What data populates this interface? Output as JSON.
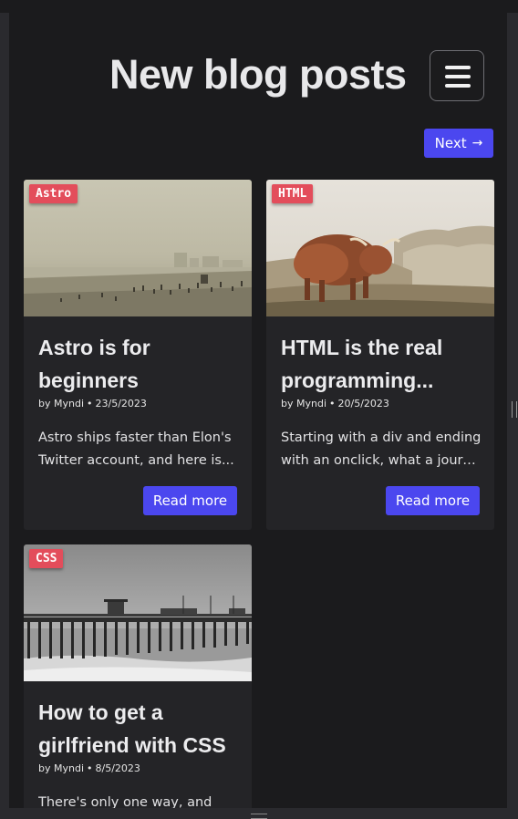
{
  "header": {
    "title": "New blog posts",
    "menu_icon": "hamburger-menu-icon"
  },
  "pagination": {
    "next_label": "Next",
    "next_icon": "→"
  },
  "colors": {
    "accent": "#4b47ef",
    "tag": "#e34d5b",
    "background": "#1b1b1d",
    "card": "#242427"
  },
  "posts": [
    {
      "tag": "Astro",
      "title_line1": "Astro is for",
      "title_line2": "beginners",
      "author": "by Myndi",
      "date": "23/5/2023",
      "excerpt_line1": "Astro ships faster than Elon's",
      "excerpt_line2": "Twitter account, and here is...",
      "read_more": "Read more",
      "image": "foggy-beach-photo"
    },
    {
      "tag": "HTML",
      "title_line1": "HTML is the real",
      "title_line2": "programming...",
      "author": "by Myndi",
      "date": "20/5/2023",
      "excerpt_line1": "Starting with a div and ending",
      "excerpt_line2": "with an onclick, what a journey.",
      "read_more": "Read more",
      "image": "highland-cow-photo"
    },
    {
      "tag": "CSS",
      "title_line1": "How to get a",
      "title_line2": "girlfriend with CSS",
      "author": "by Myndi",
      "date": "8/5/2023",
      "excerpt_line1": "There's only one way, and",
      "image": "pier-photo"
    }
  ]
}
